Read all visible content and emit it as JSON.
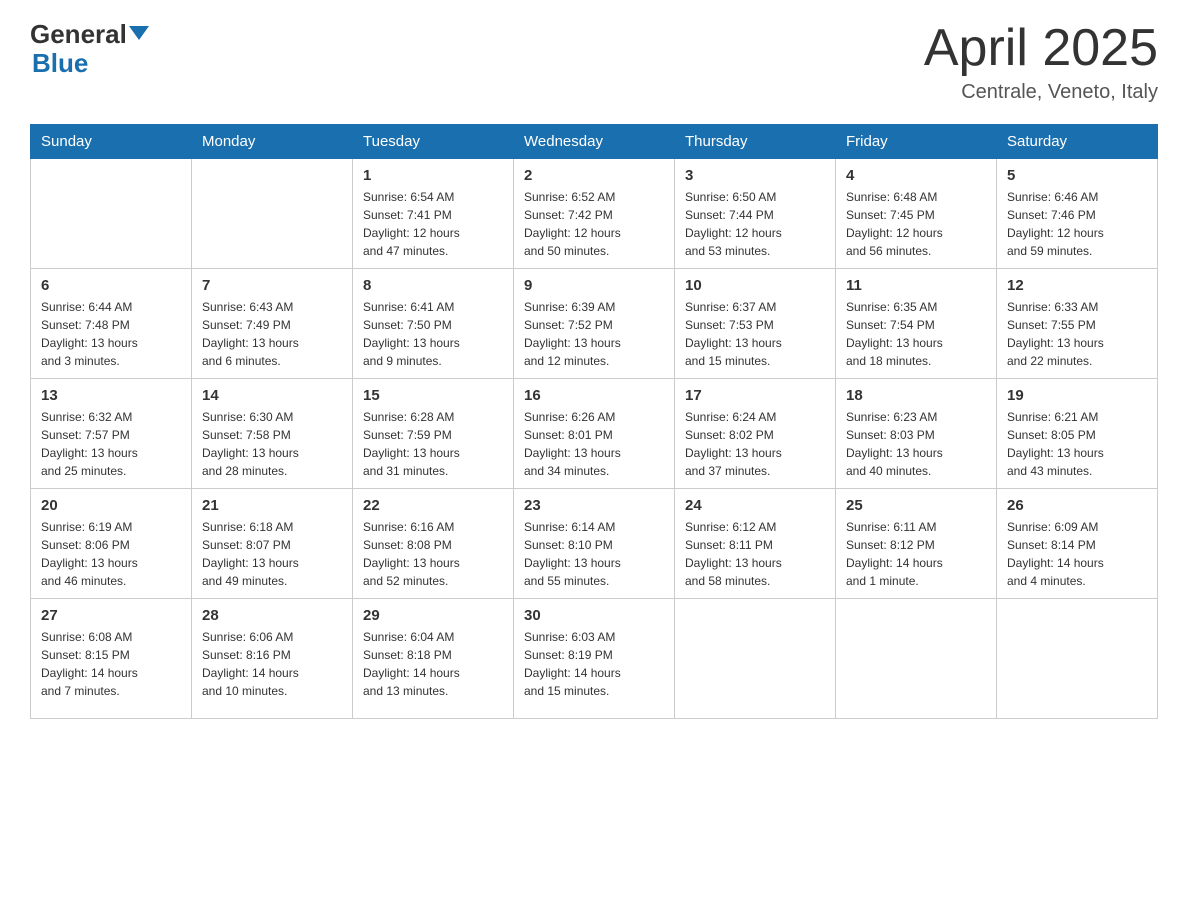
{
  "header": {
    "logo": {
      "general": "General",
      "blue": "Blue"
    },
    "title": "April 2025",
    "subtitle": "Centrale, Veneto, Italy"
  },
  "weekdays": [
    "Sunday",
    "Monday",
    "Tuesday",
    "Wednesday",
    "Thursday",
    "Friday",
    "Saturday"
  ],
  "weeks": [
    [
      {
        "day": "",
        "info": ""
      },
      {
        "day": "",
        "info": ""
      },
      {
        "day": "1",
        "info": "Sunrise: 6:54 AM\nSunset: 7:41 PM\nDaylight: 12 hours\nand 47 minutes."
      },
      {
        "day": "2",
        "info": "Sunrise: 6:52 AM\nSunset: 7:42 PM\nDaylight: 12 hours\nand 50 minutes."
      },
      {
        "day": "3",
        "info": "Sunrise: 6:50 AM\nSunset: 7:44 PM\nDaylight: 12 hours\nand 53 minutes."
      },
      {
        "day": "4",
        "info": "Sunrise: 6:48 AM\nSunset: 7:45 PM\nDaylight: 12 hours\nand 56 minutes."
      },
      {
        "day": "5",
        "info": "Sunrise: 6:46 AM\nSunset: 7:46 PM\nDaylight: 12 hours\nand 59 minutes."
      }
    ],
    [
      {
        "day": "6",
        "info": "Sunrise: 6:44 AM\nSunset: 7:48 PM\nDaylight: 13 hours\nand 3 minutes."
      },
      {
        "day": "7",
        "info": "Sunrise: 6:43 AM\nSunset: 7:49 PM\nDaylight: 13 hours\nand 6 minutes."
      },
      {
        "day": "8",
        "info": "Sunrise: 6:41 AM\nSunset: 7:50 PM\nDaylight: 13 hours\nand 9 minutes."
      },
      {
        "day": "9",
        "info": "Sunrise: 6:39 AM\nSunset: 7:52 PM\nDaylight: 13 hours\nand 12 minutes."
      },
      {
        "day": "10",
        "info": "Sunrise: 6:37 AM\nSunset: 7:53 PM\nDaylight: 13 hours\nand 15 minutes."
      },
      {
        "day": "11",
        "info": "Sunrise: 6:35 AM\nSunset: 7:54 PM\nDaylight: 13 hours\nand 18 minutes."
      },
      {
        "day": "12",
        "info": "Sunrise: 6:33 AM\nSunset: 7:55 PM\nDaylight: 13 hours\nand 22 minutes."
      }
    ],
    [
      {
        "day": "13",
        "info": "Sunrise: 6:32 AM\nSunset: 7:57 PM\nDaylight: 13 hours\nand 25 minutes."
      },
      {
        "day": "14",
        "info": "Sunrise: 6:30 AM\nSunset: 7:58 PM\nDaylight: 13 hours\nand 28 minutes."
      },
      {
        "day": "15",
        "info": "Sunrise: 6:28 AM\nSunset: 7:59 PM\nDaylight: 13 hours\nand 31 minutes."
      },
      {
        "day": "16",
        "info": "Sunrise: 6:26 AM\nSunset: 8:01 PM\nDaylight: 13 hours\nand 34 minutes."
      },
      {
        "day": "17",
        "info": "Sunrise: 6:24 AM\nSunset: 8:02 PM\nDaylight: 13 hours\nand 37 minutes."
      },
      {
        "day": "18",
        "info": "Sunrise: 6:23 AM\nSunset: 8:03 PM\nDaylight: 13 hours\nand 40 minutes."
      },
      {
        "day": "19",
        "info": "Sunrise: 6:21 AM\nSunset: 8:05 PM\nDaylight: 13 hours\nand 43 minutes."
      }
    ],
    [
      {
        "day": "20",
        "info": "Sunrise: 6:19 AM\nSunset: 8:06 PM\nDaylight: 13 hours\nand 46 minutes."
      },
      {
        "day": "21",
        "info": "Sunrise: 6:18 AM\nSunset: 8:07 PM\nDaylight: 13 hours\nand 49 minutes."
      },
      {
        "day": "22",
        "info": "Sunrise: 6:16 AM\nSunset: 8:08 PM\nDaylight: 13 hours\nand 52 minutes."
      },
      {
        "day": "23",
        "info": "Sunrise: 6:14 AM\nSunset: 8:10 PM\nDaylight: 13 hours\nand 55 minutes."
      },
      {
        "day": "24",
        "info": "Sunrise: 6:12 AM\nSunset: 8:11 PM\nDaylight: 13 hours\nand 58 minutes."
      },
      {
        "day": "25",
        "info": "Sunrise: 6:11 AM\nSunset: 8:12 PM\nDaylight: 14 hours\nand 1 minute."
      },
      {
        "day": "26",
        "info": "Sunrise: 6:09 AM\nSunset: 8:14 PM\nDaylight: 14 hours\nand 4 minutes."
      }
    ],
    [
      {
        "day": "27",
        "info": "Sunrise: 6:08 AM\nSunset: 8:15 PM\nDaylight: 14 hours\nand 7 minutes."
      },
      {
        "day": "28",
        "info": "Sunrise: 6:06 AM\nSunset: 8:16 PM\nDaylight: 14 hours\nand 10 minutes."
      },
      {
        "day": "29",
        "info": "Sunrise: 6:04 AM\nSunset: 8:18 PM\nDaylight: 14 hours\nand 13 minutes."
      },
      {
        "day": "30",
        "info": "Sunrise: 6:03 AM\nSunset: 8:19 PM\nDaylight: 14 hours\nand 15 minutes."
      },
      {
        "day": "",
        "info": ""
      },
      {
        "day": "",
        "info": ""
      },
      {
        "day": "",
        "info": ""
      }
    ]
  ]
}
